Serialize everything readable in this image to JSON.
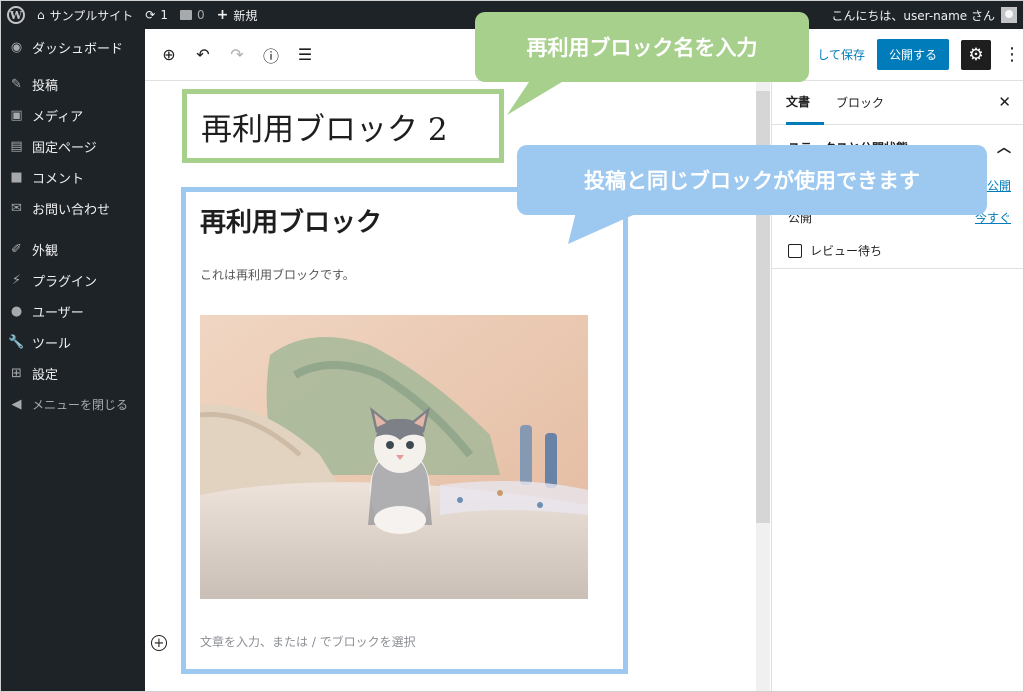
{
  "admin_bar": {
    "site_name": "サンプルサイト",
    "updates_count": "1",
    "comments_count": "0",
    "new_label": "新規",
    "greeting": "こんにちは、user-name さん"
  },
  "sidebar": {
    "items": [
      {
        "label": "ダッシュボード",
        "icon": "dashboard-icon"
      },
      {
        "label": "投稿",
        "icon": "pushpin-icon"
      },
      {
        "label": "メディア",
        "icon": "media-icon"
      },
      {
        "label": "固定ページ",
        "icon": "pages-icon"
      },
      {
        "label": "コメント",
        "icon": "comment-icon"
      },
      {
        "label": "お問い合わせ",
        "icon": "mail-icon"
      },
      {
        "label": "外観",
        "icon": "brush-icon"
      },
      {
        "label": "プラグイン",
        "icon": "plug-icon"
      },
      {
        "label": "ユーザー",
        "icon": "user-icon"
      },
      {
        "label": "ツール",
        "icon": "wrench-icon"
      },
      {
        "label": "設定",
        "icon": "settings-icon"
      },
      {
        "label": "メニューを閉じる",
        "icon": "collapse-icon"
      }
    ]
  },
  "toolbar": {
    "save_draft_label": "して保存",
    "publish_label": "公開する"
  },
  "editor": {
    "title": "再利用ブロック 2",
    "block_heading": "再利用ブロック",
    "block_paragraph": "これは再利用ブロックです。",
    "block_placeholder": "文章を入力、または / でブロックを選択"
  },
  "settings": {
    "tab_document": "文書",
    "tab_block": "ブロック",
    "panel_title": "ステータスと公開状態",
    "visibility_link": "公開",
    "publish_label": "公開",
    "publish_link": "今すぐ",
    "pending_review_label": "レビュー待ち"
  },
  "callouts": {
    "title_hint": "再利用ブロック名を入力",
    "block_hint": "投稿と同じブロックが使用できます"
  },
  "colors": {
    "admin_dark": "#1d2327",
    "primary_blue": "#007cba",
    "callout_green": "#a8d08d",
    "callout_blue": "#9dc9f0"
  }
}
